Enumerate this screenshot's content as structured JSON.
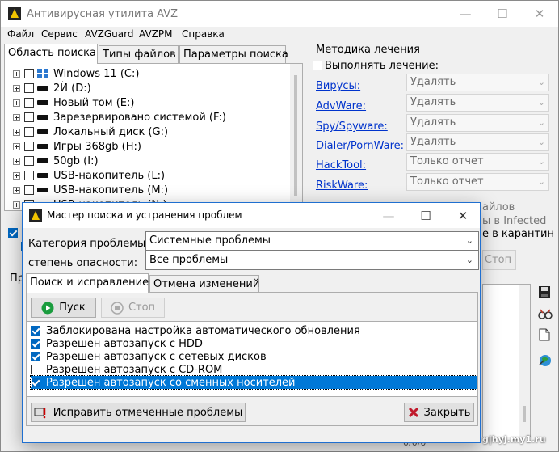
{
  "main_window": {
    "title": "Антивирусная утилита AVZ",
    "menu": [
      "Файл",
      "Сервис",
      "AVZGuard",
      "AVZPM",
      "Справка"
    ],
    "tabs": [
      "Область поиска",
      "Типы файлов",
      "Параметры поиска"
    ],
    "drives": [
      {
        "label": "Windows 11 (C:)",
        "icon": "windows-drive-icon"
      },
      {
        "label": "2Й (D:)",
        "icon": "drive-icon"
      },
      {
        "label": "Новый том (E:)",
        "icon": "drive-icon"
      },
      {
        "label": "Зарезервировано системой (F:)",
        "icon": "drive-icon"
      },
      {
        "label": "Локальный диск (G:)",
        "icon": "drive-icon"
      },
      {
        "label": "Игры 368gb (H:)",
        "icon": "drive-icon"
      },
      {
        "label": "50gb (I:)",
        "icon": "drive-icon"
      },
      {
        "label": "USB-накопитель (L:)",
        "icon": "drive-icon"
      },
      {
        "label": "USB-накопитель (M:)",
        "icon": "drive-icon"
      },
      {
        "label": "USB-накопитель (N:)",
        "icon": "drive-icon"
      }
    ],
    "treatment": {
      "legend": "Методика лечения",
      "perform_label": "Выполнять лечение:",
      "rows": [
        {
          "label": "Вирусы:",
          "value": "Удалять"
        },
        {
          "label": "AdvWare:",
          "value": "Удалять"
        },
        {
          "label": "Spy/Spyware:",
          "value": "Удалять"
        },
        {
          "label": "Dialer/PornWare:",
          "value": "Удалять"
        },
        {
          "label": "HackTool:",
          "value": "Только отчет"
        },
        {
          "label": "RiskWare:",
          "value": "Только отчет"
        }
      ],
      "behind_text_1": "айлов",
      "behind_text_2": "ы в  Infected",
      "behind_text_3": "е в  карантин",
      "stop_button": "Стоп"
    },
    "side_tab_label": "Пр",
    "bottom_status": "0/0/0",
    "side_icons": [
      "save-icon",
      "glasses-icon",
      "document-icon",
      "globe-icon"
    ]
  },
  "dialog": {
    "title": "Мастер поиска и устранения проблем",
    "category_label": "Категория проблемы:",
    "category_value": "Системные проблемы",
    "severity_label": "степень опасности:",
    "severity_value": "Все проблемы",
    "tabs": [
      "Поиск и исправление",
      "Отмена изменений"
    ],
    "start_button": "Пуск",
    "stop_button": "Стоп",
    "problems": [
      {
        "label": "Заблокирована настройка автоматического обновления",
        "checked": true,
        "selected": false
      },
      {
        "label": "Разрешен автозапуск с HDD",
        "checked": true,
        "selected": false
      },
      {
        "label": "Разрешен автозапуск с сетевых дисков",
        "checked": true,
        "selected": false
      },
      {
        "label": "Разрешен автозапуск с CD-ROM",
        "checked": false,
        "selected": false
      },
      {
        "label": "Разрешен автозапуск со сменных носителей",
        "checked": true,
        "selected": true
      }
    ],
    "fix_button": "Исправить отмеченные проблемы",
    "close_button": "Закрыть"
  },
  "watermark": "g|hyj.my1.ru",
  "colors": {
    "accent": "#0078d7",
    "link": "#0033cc",
    "dialog_border": "#1f6fd0"
  }
}
